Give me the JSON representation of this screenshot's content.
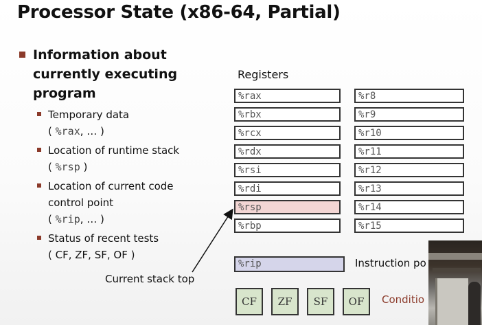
{
  "title": "Processor State (x86-64, Partial)",
  "main_bullet": {
    "lines": [
      "Information about",
      "currently executing",
      "program"
    ]
  },
  "sub_bullets": [
    {
      "line1": "Temporary data",
      "line2_mono": "%rax",
      "line2_suffix": ", … )"
    },
    {
      "line1": "Location of runtime stack",
      "line2_mono": "%rsp",
      "line2_suffix": ")"
    },
    {
      "line1": "Location of current code",
      "line1b": "control point",
      "line2_mono": "%rip",
      "line2_suffix": ", … )"
    },
    {
      "line1": "Status of recent tests",
      "line2_text": "( CF, ZF, SF, OF )"
    }
  ],
  "registers": {
    "heading": "Registers",
    "left": [
      "%rax",
      "%rbx",
      "%rcx",
      "%rdx",
      "%rsi",
      "%rdi",
      "%rsp",
      "%rbp"
    ],
    "right": [
      "%r8",
      "%r9",
      "%r10",
      "%r11",
      "%r12",
      "%r13",
      "%r14",
      "%r15"
    ],
    "highlighted": "%rsp",
    "highlight_color": "#f3d6d4"
  },
  "instruction_pointer": {
    "register": "%rip",
    "label": "Instruction po",
    "color": "#d5d5ea"
  },
  "flags": {
    "items": [
      "CF",
      "ZF",
      "SF",
      "OF"
    ],
    "label": "Conditio",
    "color": "#d8e5cc"
  },
  "annotation": {
    "text": "Current stack top"
  },
  "colors": {
    "bullet": "#8b3a2a"
  }
}
